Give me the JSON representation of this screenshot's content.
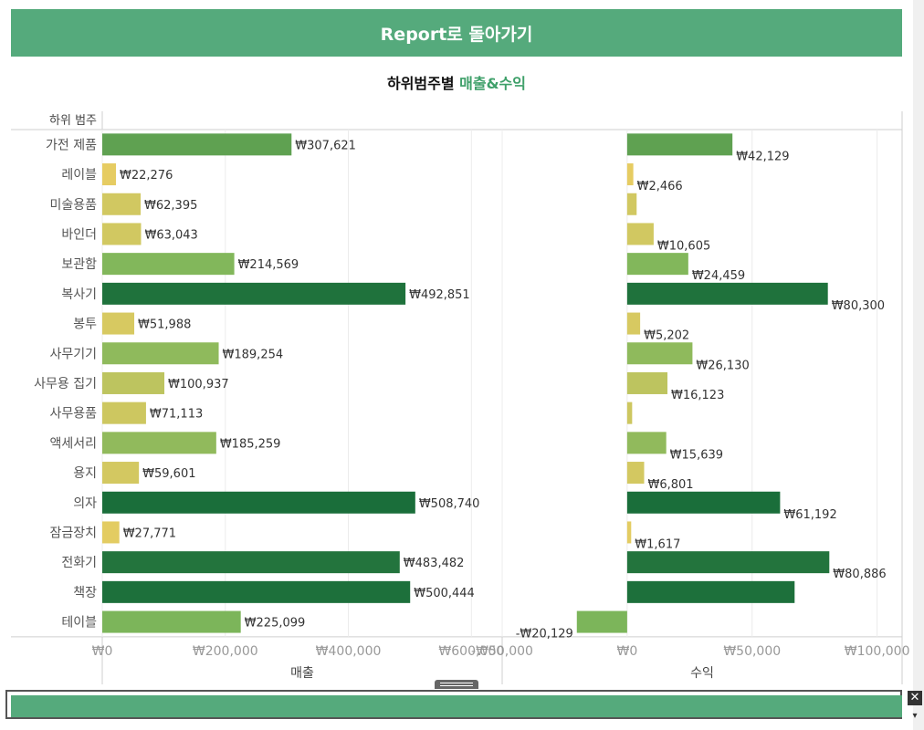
{
  "back_button": {
    "label": "Report로 돌아가기"
  },
  "title": {
    "prefix": "하위범주별 ",
    "accent": "매출&수익"
  },
  "chart_data": {
    "type": "bar",
    "row_header": "하위 범주",
    "categories": [
      "가전 제품",
      "레이블",
      "미술용품",
      "바인더",
      "보관함",
      "복사기",
      "봉투",
      "사무기기",
      "사무용 집기",
      "사무용품",
      "액세서리",
      "용지",
      "의자",
      "잠금장치",
      "전화기",
      "책장",
      "테이블"
    ],
    "series": [
      {
        "name": "매출",
        "values": [
          307621,
          22276,
          62395,
          63043,
          214569,
          492851,
          51988,
          189254,
          100937,
          71113,
          185259,
          59601,
          508740,
          27771,
          483482,
          500444,
          225099
        ],
        "labels": [
          "₩307,621",
          "₩22,276",
          "₩62,395",
          "₩63,043",
          "₩214,569",
          "₩492,851",
          "₩51,988",
          "₩189,254",
          "₩100,937",
          "₩71,113",
          "₩185,259",
          "₩59,601",
          "₩508,740",
          "₩27,771",
          "₩483,482",
          "₩500,444",
          "₩225,099"
        ]
      },
      {
        "name": "수익",
        "values": [
          42129,
          2466,
          3800,
          10605,
          24459,
          80300,
          5202,
          26130,
          16123,
          2000,
          15639,
          6801,
          61192,
          1617,
          80886,
          67000,
          -20129
        ],
        "labels": [
          "₩42,129",
          "₩2,466",
          "",
          "₩10,605",
          "₩24,459",
          "₩80,300",
          "₩5,202",
          "₩26,130",
          "₩16,123",
          "",
          "₩15,639",
          "₩6,801",
          "₩61,192",
          "₩1,617",
          "₩80,886",
          "",
          "-₩20,129"
        ]
      }
    ],
    "panels": [
      {
        "xlabel": "매출",
        "xlim": [
          0,
          650000
        ],
        "ticks": [
          0,
          200000,
          400000,
          600000
        ],
        "tick_labels": [
          "₩0",
          "₩200,000",
          "₩400,000",
          "₩600,000"
        ]
      },
      {
        "xlabel": "수익",
        "xlim": [
          -50000,
          110000
        ],
        "ticks": [
          -50000,
          0,
          50000,
          100000
        ],
        "tick_labels": [
          "-₩50,000",
          "₩0",
          "₩50,000",
          "₩100,000"
        ]
      }
    ],
    "colors": {
      "low": "#f2cf63",
      "high": "#1a6e3a"
    },
    "grid": true
  }
}
